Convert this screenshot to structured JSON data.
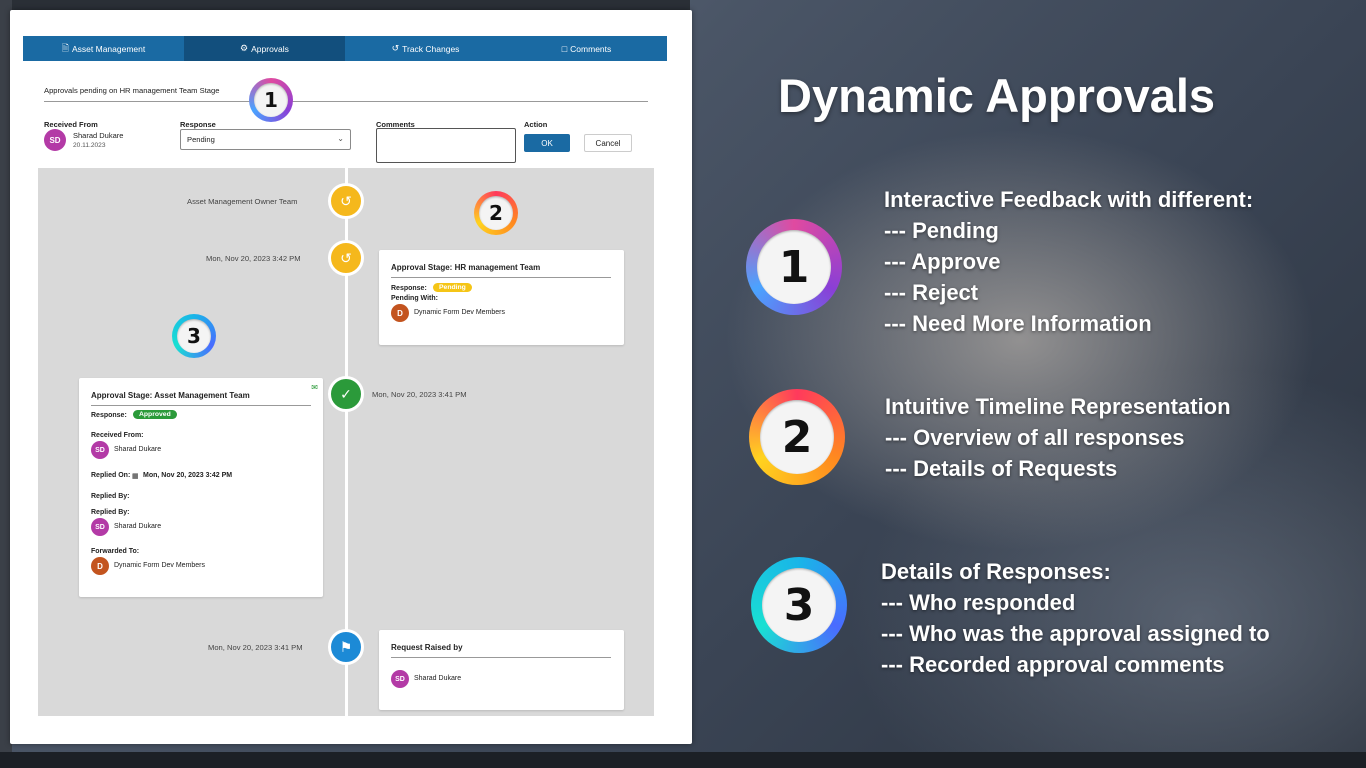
{
  "tabs": [
    {
      "label": "Asset Management",
      "icon": "document-icon"
    },
    {
      "label": "Approvals",
      "icon": "approvals-icon"
    },
    {
      "label": "Track Changes",
      "icon": "history-icon"
    },
    {
      "label": "Comments",
      "icon": "comment-icon"
    }
  ],
  "active_tab": "Approvals",
  "form": {
    "pending_title": "Approvals pending on HR management Team Stage",
    "received_from_label": "Received From",
    "received_initials": "SD",
    "received_name": "Sharad Dukare",
    "received_date": "20.11.2023",
    "response_label": "Response",
    "response_value": "Pending",
    "comments_label": "Comments",
    "comments_value": "",
    "action_label": "Action",
    "ok_label": "OK",
    "cancel_label": "Cancel"
  },
  "timeline": {
    "owner_team": "Asset Management Owner Team",
    "pending_time": "Mon, Nov 20, 2023 3:42 PM",
    "pending_card": {
      "title": "Approval Stage: HR management Team",
      "response_label": "Response:",
      "response_value": "Pending",
      "pending_with_label": "Pending With:",
      "member_initial": "D",
      "member_name": "Dynamic Form Dev Members"
    },
    "approved_time": "Mon, Nov 20, 2023 3:41 PM",
    "approved_card": {
      "title": "Approval Stage: Asset Management Team",
      "response_label": "Response:",
      "response_value": "Approved",
      "received_from_label": "Received From:",
      "received_initials": "SD",
      "received_name": "Sharad Dukare",
      "replied_on_label": "Replied On:",
      "replied_on_value": "Mon, Nov 20, 2023 3:42 PM",
      "replied_by_label_1": "Replied By:",
      "replied_by_label_2": "Replied By:",
      "replied_initials": "SD",
      "replied_name": "Sharad Dukare",
      "forwarded_label": "Forwarded To:",
      "forwarded_initial": "D",
      "forwarded_name": "Dynamic Form Dev Members"
    },
    "request_time": "Mon, Nov 20, 2023 3:41 PM",
    "request_card": {
      "title": "Request Raised by",
      "initials": "SD",
      "name": "Sharad Dukare"
    }
  },
  "markers": [
    "1",
    "2",
    "3"
  ],
  "hero": {
    "title": "Dynamic Approvals",
    "feature1": [
      "Interactive Feedback with different:",
      "--- Pending",
      "--- Approve",
      "--- Reject",
      "--- Need More Information"
    ],
    "feature2": [
      "Intuitive Timeline Representation",
      "--- Overview of all responses",
      "--- Details of Requests"
    ],
    "feature3": [
      "Details of Responses:",
      "--- Who responded",
      "--- Who was the approval assigned to",
      "--- Recorded approval comments"
    ]
  },
  "colors": {
    "tab_bar": "#1a6aa3",
    "tab_active": "#124f7d",
    "pending": "#f5c516",
    "approved": "#2b9a3a",
    "flag_node": "#1c8ad6",
    "avatar_purple": "#b33aa6",
    "avatar_orange": "#c3541f"
  }
}
